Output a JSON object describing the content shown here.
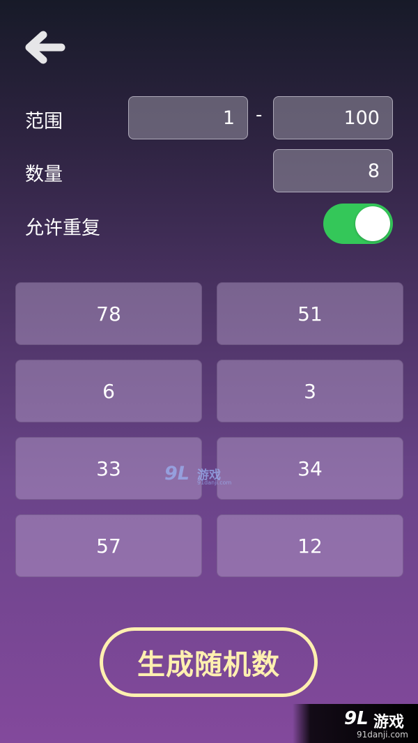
{
  "header": {
    "back_icon": "arrow-left-icon"
  },
  "settings": {
    "range_label": "范围",
    "range_min": "1",
    "range_separator": "-",
    "range_max": "100",
    "count_label": "数量",
    "count_value": "8",
    "allow_repeat_label": "允许重复",
    "allow_repeat_enabled": true
  },
  "results": [
    "78",
    "51",
    "6",
    "3",
    "33",
    "34",
    "57",
    "12"
  ],
  "generate_button": {
    "label": "生成随机数"
  },
  "watermark_center": {
    "logo": "9L",
    "text": "游戏",
    "url": "91danji.com"
  },
  "watermark_corner": {
    "logo": "9L",
    "text": "游戏",
    "url": "91danji.com"
  },
  "colors": {
    "toggle_on": "#34c759",
    "button_accent": "#fff0b0",
    "background_top": "#171a28",
    "background_bottom": "#83499c"
  }
}
